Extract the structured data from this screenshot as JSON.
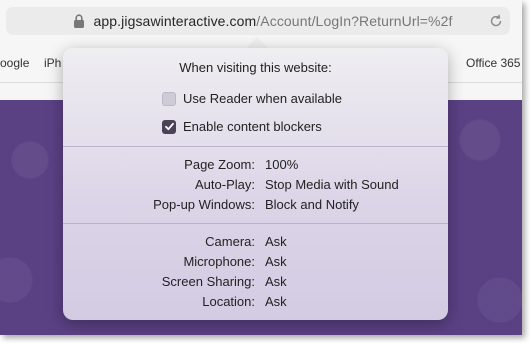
{
  "address_bar": {
    "host": "app.jigsawinteractive.com",
    "path": "/Account/LogIn?ReturnUrl=%2f"
  },
  "favorites": [
    "oogle",
    "iPh",
    "Office 365"
  ],
  "popover": {
    "title": "When visiting this website:",
    "reader": {
      "label": "Use Reader when available",
      "checked": false
    },
    "content_blockers": {
      "label": "Enable content blockers",
      "checked": true
    },
    "settings_group1": [
      {
        "label": "Page Zoom:",
        "value": "100%"
      },
      {
        "label": "Auto-Play:",
        "value": "Stop Media with Sound"
      },
      {
        "label": "Pop-up Windows:",
        "value": "Block and Notify"
      }
    ],
    "settings_group2": [
      {
        "label": "Camera:",
        "value": "Ask"
      },
      {
        "label": "Microphone:",
        "value": "Ask"
      },
      {
        "label": "Screen Sharing:",
        "value": "Ask"
      },
      {
        "label": "Location:",
        "value": "Ask"
      }
    ]
  },
  "icons": {
    "lock": "lock-icon",
    "reload": "reload-icon",
    "check": "checkmark-icon"
  },
  "colors": {
    "page_background": "#5a4184",
    "popover_accent": "#dcd5e8"
  }
}
